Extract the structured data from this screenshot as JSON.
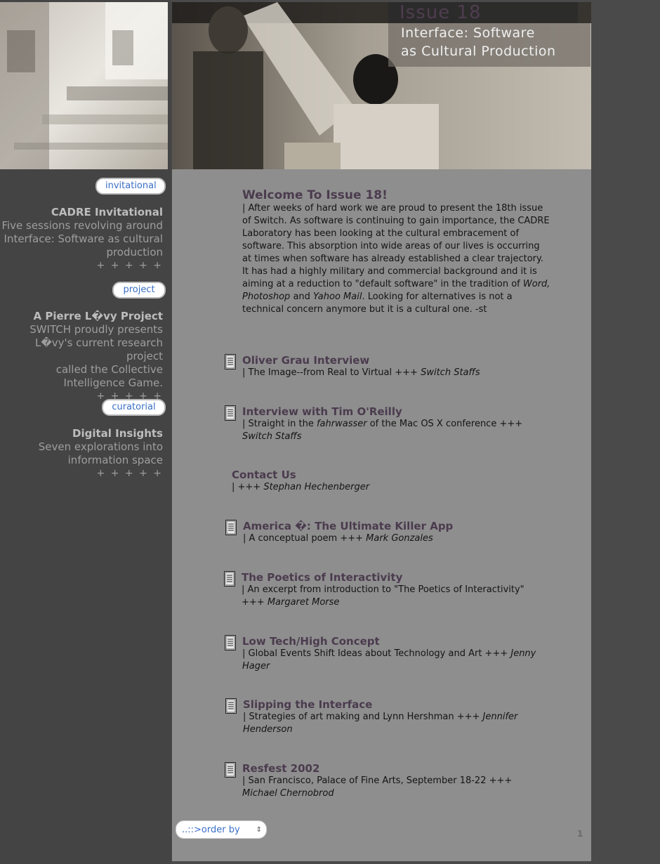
{
  "header": {
    "issue_number": "Issue 18",
    "issue_subtitle_line1": "Interface: Software",
    "issue_subtitle_line2": "as Cultural Production"
  },
  "sidebar": {
    "sections": [
      {
        "pill_label": "invitational",
        "title": "CADRE Invitational",
        "text_lines": [
          "Five sessions revolving around",
          "Interface: Software as cultural",
          "production"
        ],
        "plus": "+ + + + +"
      },
      {
        "pill_label": "project",
        "title": "A Pierre L�vy Project",
        "text_lines": [
          "SWITCH proudly presents",
          "L�vy's current research project",
          "called the Collective",
          "Intelligence Game."
        ],
        "plus": "+ + + + +"
      },
      {
        "pill_label": "curatorial",
        "title": "Digital Insights",
        "text_lines": [
          "Seven explorations into",
          "information space"
        ],
        "plus": "+ + + + +"
      }
    ]
  },
  "welcome": {
    "title": "Welcome To Issue 18!",
    "body_pre": "| After weeks of hard work we are proud to present the 18th issue of Switch. As software is continuing to gain importance, the CADRE Laboratory has been looking at the cultural embracement of software. This absorption into wide areas of our lives is occurring at times when software has already established a clear trajectory. It has had a highly military and commercial background and it is aiming at a reduction to \"default software\" in the tradition of ",
    "body_italic_1": "Word, Photoshop",
    "body_and": " and ",
    "body_italic_2": "Yahoo Mail",
    "body_post": ". Looking for alternatives is not a technical concern anymore but it is a cultural one. -st"
  },
  "articles": [
    {
      "title": "Oliver Grau Interview",
      "desc": "| The Image--from Real to Virtual +++ ",
      "author": "Switch Staffs",
      "has_icon": true
    },
    {
      "title": "Interview with Tim O'Reilly",
      "desc_pre": "| Straight in the ",
      "desc_italic": "fahrwasser",
      "desc_post": " of the Mac OS X conference +++ ",
      "author": "Switch Staffs",
      "has_icon": true
    },
    {
      "title": "Contact Us",
      "desc": "| +++ ",
      "author": "Stephan Hechenberger",
      "has_icon": false
    },
    {
      "title": "America �: The Ultimate Killer App",
      "desc": "| A conceptual poem +++ ",
      "author": "Mark Gonzales",
      "has_icon": true
    },
    {
      "title": "The Poetics of Interactivity",
      "desc": "| An excerpt from introduction to \"The Poetics of Interactivity\" +++ ",
      "author": "Margaret Morse",
      "has_icon": true
    },
    {
      "title": "Low Tech/High Concept",
      "desc": "| Global Events Shift Ideas about Technology and Art +++ ",
      "author": "Jenny Hager",
      "has_icon": true
    },
    {
      "title": "Slipping the Interface",
      "desc": "| Strategies of art making and Lynn Hershman +++ ",
      "author": "Jennifer Henderson",
      "has_icon": true
    },
    {
      "title": "Resfest 2002",
      "desc": "| San Francisco, Palace of Fine Arts, September 18-22 +++ ",
      "author": "Michael Chernobrod",
      "has_icon": true
    }
  ],
  "footer": {
    "order_select_value": "..::>order by",
    "page_number": "1"
  },
  "colors": {
    "title_purple": "#4b3b4e",
    "link_blue": "#3a6fc7",
    "content_bg": "#8e8e8e",
    "sidebar_bg": "#444444"
  },
  "icons": [
    "document-icon",
    "chevron-updown-icon"
  ]
}
